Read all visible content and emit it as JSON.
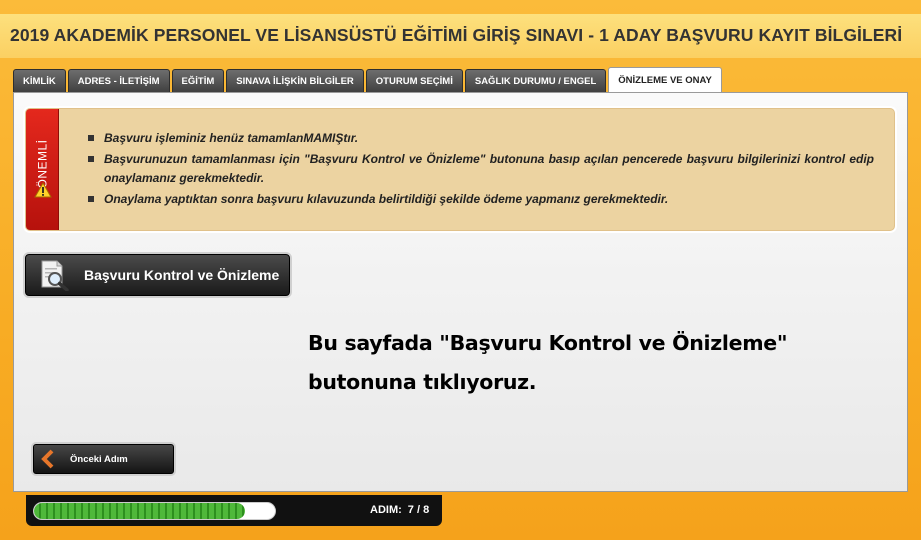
{
  "header": {
    "title": "2019 AKADEMİK PERSONEL VE LİSANSÜSTÜ EĞİTİMİ GİRİŞ SINAVI - 1 ADAY BAŞVURU KAYIT BİLGİLERİ"
  },
  "tabs": [
    {
      "label": "KİMLİK",
      "active": false
    },
    {
      "label": "ADRES - İLETİŞİM",
      "active": false
    },
    {
      "label": "EĞİTİM",
      "active": false
    },
    {
      "label": "SINAVA İLİŞKİN BİLGİLER",
      "active": false
    },
    {
      "label": "OTURUM SEÇİMİ",
      "active": false
    },
    {
      "label": "SAĞLIK DURUMU / ENGEL",
      "active": false
    },
    {
      "label": "ÖNİZLEME VE ONAY",
      "active": true
    }
  ],
  "notice": {
    "side_label": "ÖNEMLİ",
    "icon": "warning-triangle-icon",
    "items": [
      "Başvuru işleminiz henüz tamamlanMAMIŞtır.",
      "Başvurunuzun tamamlanması için \"Başvuru Kontrol ve Önizleme\" butonuna basıp açılan pencerede başvuru bilgilerinizi kontrol edip onaylamanız gerekmektedir.",
      "Onaylama yaptıktan sonra başvuru kılavuzunda belirtildiği şekilde ödeme yapmanız gerekmektedir."
    ]
  },
  "preview_button": {
    "label": "Başvuru Kontrol ve Önizleme",
    "icon": "document-search-icon"
  },
  "caption": "Bu sayfada \"Başvuru Kontrol ve Önizleme\" butonuna tıklıyoruz.",
  "back_button": {
    "label": "Önceki Adım",
    "icon": "chevron-left-icon"
  },
  "status": {
    "step_label": "ADIM:",
    "step_value": "7 / 8",
    "progress_fraction": 0.875
  },
  "colors": {
    "frame": "#f8ac24",
    "title_band": "#fbd062",
    "notice_bg": "#ecd3a1",
    "notice_side": "#d01f15",
    "progress": "#3aa22a"
  }
}
